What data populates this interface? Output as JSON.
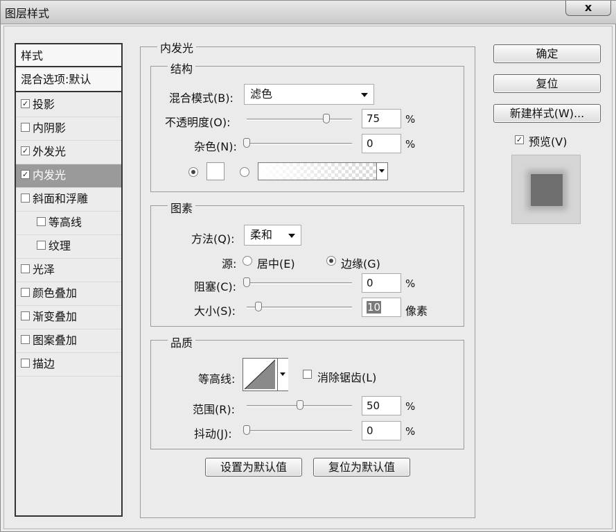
{
  "window": {
    "title": "图层样式",
    "close_label": "x"
  },
  "styles_panel": {
    "header": "样式",
    "blend_options": "混合选项:默认",
    "items": [
      {
        "label": "投影",
        "checked": true
      },
      {
        "label": "内阴影",
        "checked": false
      },
      {
        "label": "外发光",
        "checked": true
      },
      {
        "label": "内发光",
        "checked": true,
        "selected": true
      },
      {
        "label": "斜面和浮雕",
        "checked": false
      },
      {
        "label": "等高线",
        "checked": false
      },
      {
        "label": "纹理",
        "checked": false
      },
      {
        "label": "光泽",
        "checked": false
      },
      {
        "label": "颜色叠加",
        "checked": false
      },
      {
        "label": "渐变叠加",
        "checked": false
      },
      {
        "label": "图案叠加",
        "checked": false
      },
      {
        "label": "描边",
        "checked": false
      }
    ]
  },
  "inner_glow": {
    "title": "内发光",
    "structure": {
      "title": "结构",
      "blend_mode_label": "混合模式(B):",
      "blend_mode_value": "滤色",
      "opacity_label": "不透明度(O):",
      "opacity_value": "75",
      "opacity_unit": "%",
      "noise_label": "杂色(N):",
      "noise_value": "0",
      "noise_unit": "%",
      "color_selected": true,
      "glow_color": "#ffffff"
    },
    "elements": {
      "title": "图素",
      "method_label": "方法(Q):",
      "method_value": "柔和",
      "source_label": "源:",
      "source_center_label": "居中(E)",
      "source_edge_label": "边缘(G)",
      "source_selected": "边缘",
      "choke_label": "阻塞(C):",
      "choke_value": "0",
      "choke_unit": "%",
      "size_label": "大小(S):",
      "size_value": "10",
      "size_unit": "像素"
    },
    "quality": {
      "title": "品质",
      "contour_label": "等高线:",
      "antialias_label": "消除锯齿(L)",
      "antialias_checked": false,
      "range_label": "范围(R):",
      "range_value": "50",
      "range_unit": "%",
      "jitter_label": "抖动(J):",
      "jitter_value": "0",
      "jitter_unit": "%"
    },
    "make_default_label": "设置为默认值",
    "reset_default_label": "复位为默认值"
  },
  "actions": {
    "ok_label": "确定",
    "reset_label": "复位",
    "new_style_label": "新建样式(W)...",
    "preview_label": "预览(V)",
    "preview_checked": true
  }
}
